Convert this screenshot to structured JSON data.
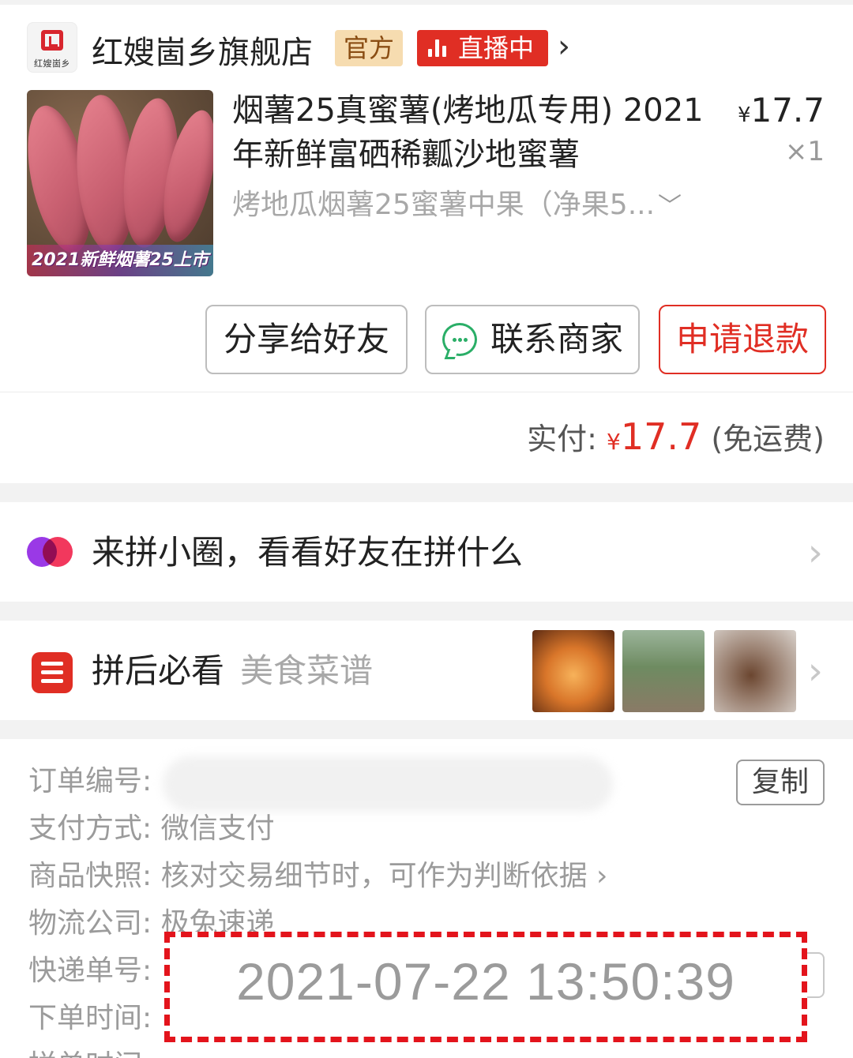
{
  "store": {
    "name": "红嫂崮乡旗舰店",
    "logo_text": "红嫂崮乡",
    "official_badge": "官方",
    "live_badge": "直播中",
    "arrow": "›"
  },
  "product": {
    "title_line1": "烟薯25真蜜薯(烤地瓜专用) 2021",
    "title_line2": "年新鲜富硒稀瓤沙地蜜薯",
    "price_symbol": "¥",
    "price": "17.7",
    "quantity": "×1",
    "spec": "烤地瓜烟薯25蜜薯中果（净果5...",
    "image_caption": "2021新鲜烟薯25上市"
  },
  "actions": {
    "share": "分享给好友",
    "contact": "联系商家",
    "refund": "申请退款"
  },
  "payment": {
    "label": "实付:",
    "symbol": "¥",
    "amount": "17.7",
    "note": "(免运费)"
  },
  "circle": {
    "text": "来拼小圈，看看好友在拼什么"
  },
  "recipe": {
    "title": "拼后必看",
    "subtitle": "美食菜谱"
  },
  "order": {
    "number_label": "订单编号:",
    "copy_label": "复制",
    "pay_method_label": "支付方式:",
    "pay_method_value": "微信支付",
    "snapshot_label": "商品快照:",
    "snapshot_value": "核对交易细节时，可作为判断依据 ›",
    "logistics_label": "物流公司:",
    "logistics_value": "极兔速递",
    "tracking_label": "快递单号:",
    "order_time_label": "下单时间:",
    "order_time_value": "2021-07-22 13:50:39",
    "next_label": "拼单时间:"
  },
  "colors": {
    "accent_red": "#e02e24",
    "wechat_green": "#2aae67",
    "official_gold": "#f6dcb0"
  }
}
